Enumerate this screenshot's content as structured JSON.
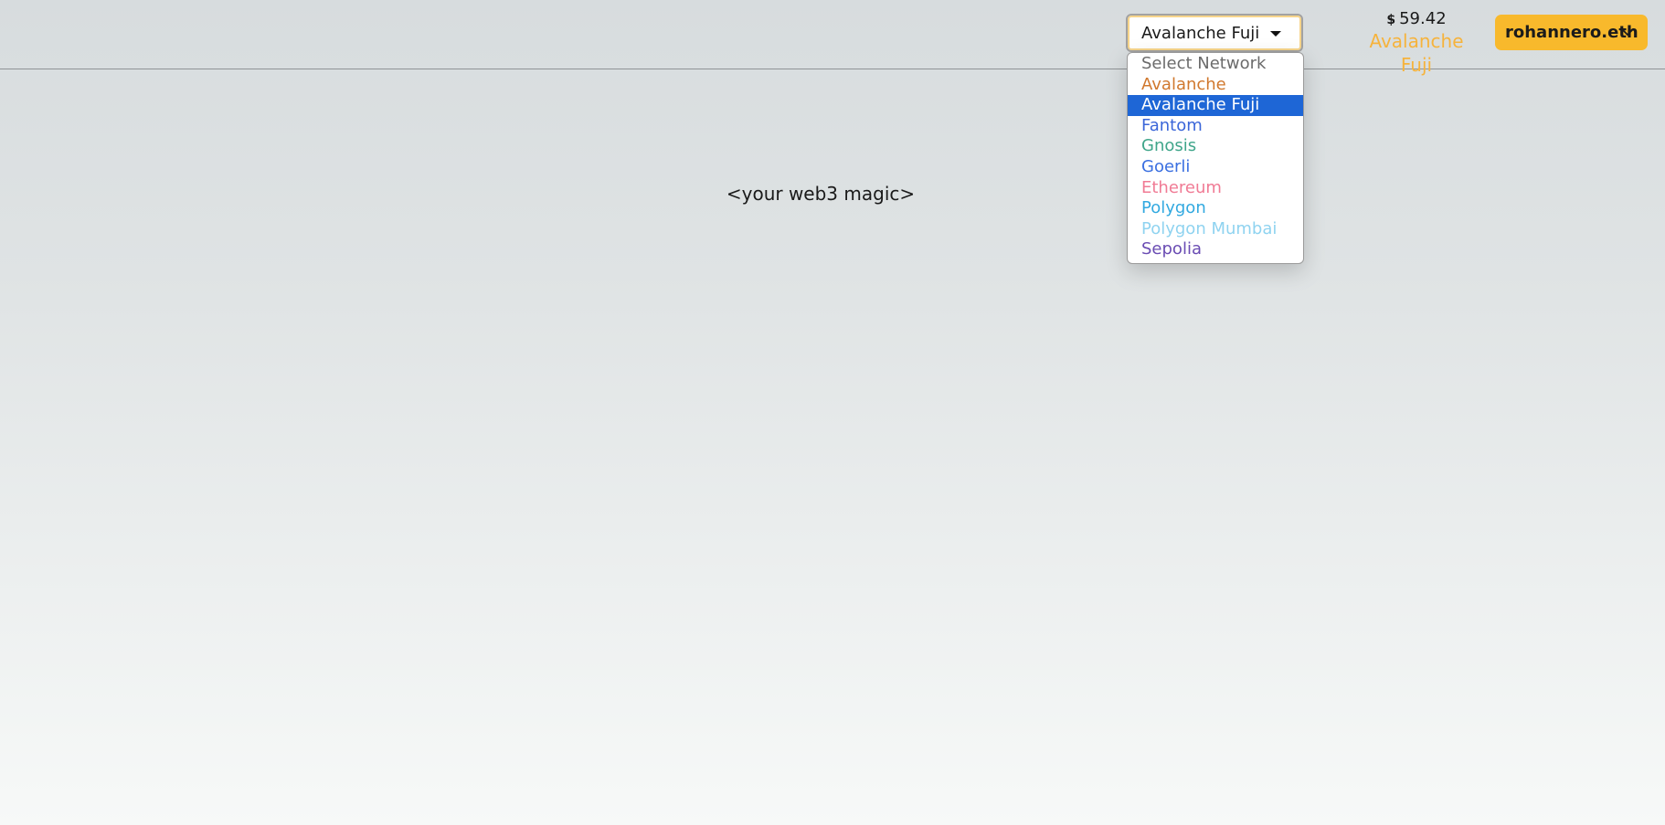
{
  "network_select": {
    "selected": "Avalanche Fuji",
    "options": [
      {
        "label": "Select Network",
        "color": "#6b6b6b"
      },
      {
        "label": "Avalanche",
        "color": "#d0782e"
      },
      {
        "label": "Avalanche Fuji",
        "color": "#e3a33a",
        "selected": true
      },
      {
        "label": "Fantom",
        "color": "#3b66d9"
      },
      {
        "label": "Gnosis",
        "color": "#3fa58a"
      },
      {
        "label": "Goerli",
        "color": "#3a6fe0"
      },
      {
        "label": "Ethereum",
        "color": "#f07b95"
      },
      {
        "label": "Polygon",
        "color": "#32a9e0"
      },
      {
        "label": "Polygon Mumbai",
        "color": "#8fd3f0"
      },
      {
        "label": "Sepolia",
        "color": "#6a4cb3"
      }
    ]
  },
  "balance": {
    "currency_symbol": "$",
    "amount": "59.42",
    "chain": "Avalanche Fuji"
  },
  "account": {
    "name": "rohannero.eth",
    "icon": "chevron-down-icon"
  },
  "main": {
    "placeholder_text": "<your web3 magic>"
  }
}
